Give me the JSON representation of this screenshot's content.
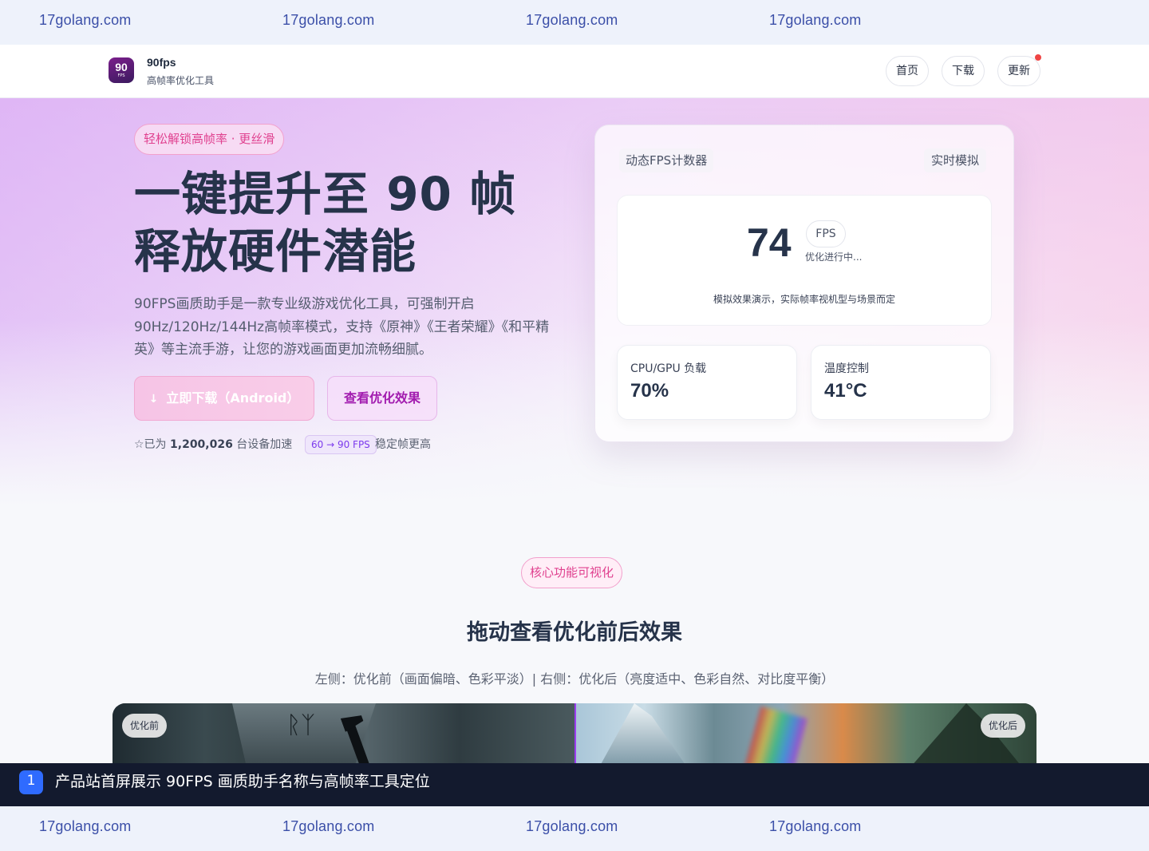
{
  "watermark": {
    "text": "17golang.com"
  },
  "header": {
    "logo_big": "90",
    "logo_small": "FPS",
    "brand_name": "90fps",
    "brand_subtitle": "高帧率优化工具",
    "nav": [
      "首页",
      "下载",
      "更新"
    ]
  },
  "hero": {
    "tag": "轻松解锁高帧率 · 更丝滑",
    "title_line1": "一键提升至 90 帧",
    "title_line2": "释放硬件潜能",
    "description": "90FPS画质助手是一款专业级游戏优化工具，可强制开启90Hz/120Hz/144Hz高帧率模式，支持《原神》《王者荣耀》《和平精英》等主流手游，让您的游戏画面更加流畅细腻。",
    "download_icon": "↓",
    "download_label": "立即下载（Android）",
    "effect_label": "查看优化效果",
    "stats_prefix": "☆已为",
    "stats_count": "1,200,026",
    "stats_suffix": "台设备加速",
    "fps_badge": "60 → 90 FPS",
    "fps_badge_suffix": "稳定帧更高"
  },
  "fps_card": {
    "title": "动态FPS计数器",
    "mode": "实时模拟",
    "fps_value": "74",
    "fps_unit": "FPS",
    "fps_status": "优化进行中...",
    "note": "模拟效果演示，实际帧率视机型与场景而定",
    "metrics": [
      {
        "label": "CPU/GPU 负载",
        "value": "70%"
      },
      {
        "label": "温度控制",
        "value": "41°C"
      }
    ]
  },
  "features": {
    "tag": "核心功能可视化",
    "title": "拖动查看优化前后效果",
    "description": "左侧：优化前（画面偏暗、色彩平淡）| 右侧：优化后（亮度适中、色彩自然、对比度平衡）",
    "before_label": "优化前",
    "after_label": "优化后"
  },
  "caption": {
    "number": "1",
    "text": "产品站首屏展示 90FPS 画质助手名称与高帧率工具定位"
  },
  "colors": {
    "accent_pink": "#e0418f",
    "accent_purple": "#a21caf",
    "divider": "#9b3cf0",
    "caption_bg": "#131a2e",
    "caption_num_bg": "#2f6bff",
    "notification_dot": "#ef4444"
  }
}
